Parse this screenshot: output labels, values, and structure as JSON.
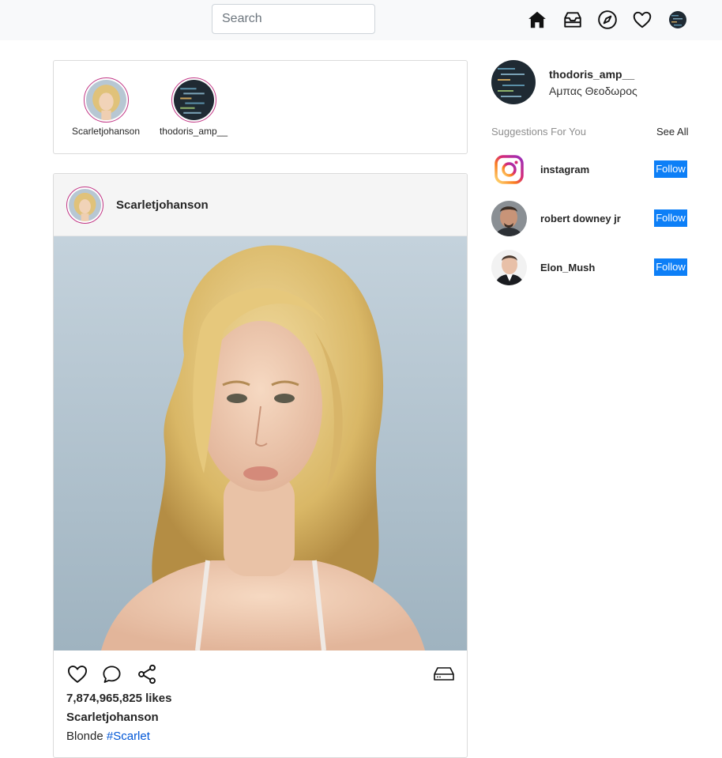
{
  "navbar": {
    "search_placeholder": "Search",
    "icons": [
      "home-icon",
      "inbox-icon",
      "explore-icon",
      "heart-icon",
      "profile-avatar"
    ]
  },
  "stories": [
    {
      "username": "Scarletjohanson"
    },
    {
      "username": "thodoris_amp__"
    }
  ],
  "post": {
    "username": "Scarletjohanson",
    "likes_text": "7,874,965,825 likes",
    "caption_user": "Scarletjohanson",
    "caption_text": "Blonde ",
    "caption_tag": "#Scarlet"
  },
  "sidebar": {
    "username": "thodoris_amp__",
    "full_name": "Αμπας Θεοδωρος",
    "suggestions_title": "Suggestions For You",
    "see_all": "See All",
    "suggestions": [
      {
        "username": "instagram",
        "button": "Follow"
      },
      {
        "username": "robert downey jr",
        "button": "Follow"
      },
      {
        "username": "Elon_Mush",
        "button": "Follow"
      }
    ]
  },
  "colors": {
    "follow_button": "#0d7ff7",
    "hashtag": "#0056d6",
    "story_ring": "#c13584",
    "navbar_bg": "#f8f9fa"
  }
}
